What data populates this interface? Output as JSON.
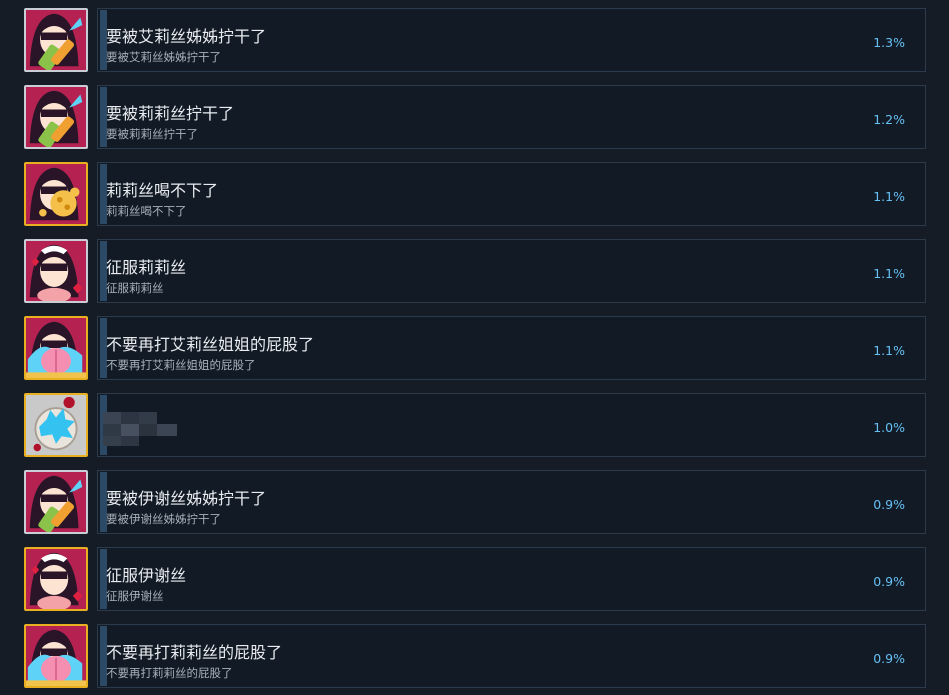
{
  "achievements": [
    {
      "title": "要被艾莉丝姊姊拧干了",
      "description": "要被艾莉丝姊姊拧干了",
      "percent": "1.3%",
      "percent_value": 1.3,
      "icon": "girl-with-lotion-icon",
      "border_color": "#c9ced6",
      "bg_color": "#b52252"
    },
    {
      "title": "要被莉莉丝拧干了",
      "description": "要被莉莉丝拧干了",
      "percent": "1.2%",
      "percent_value": 1.2,
      "icon": "girl-with-lotion-icon",
      "border_color": "#c9ced6",
      "bg_color": "#b52252"
    },
    {
      "title": "莉莉丝喝不下了",
      "description": "莉莉丝喝不下了",
      "percent": "1.1%",
      "percent_value": 1.1,
      "icon": "girl-with-splash-icon",
      "border_color": "#e8b020",
      "bg_color": "#b52252"
    },
    {
      "title": "征服莉莉丝",
      "description": "征服莉莉丝",
      "percent": "1.1%",
      "percent_value": 1.1,
      "icon": "maid-girl-hearts-icon",
      "border_color": "#c9ced6",
      "bg_color": "#b52252"
    },
    {
      "title": "不要再打艾莉丝姐姐的屁股了",
      "description": "不要再打艾莉丝姐姐的屁股了",
      "percent": "1.1%",
      "percent_value": 1.1,
      "icon": "girl-with-peach-icon",
      "border_color": "#e8b020",
      "bg_color": "#b52252"
    },
    {
      "title": "",
      "description": "",
      "percent": "1.0%",
      "percent_value": 1.0,
      "icon": "splash-plate-icon",
      "border_color": "#e8b020",
      "bg_color": "#c9c9c9",
      "hidden": true
    },
    {
      "title": "要被伊谢丝姊姊拧干了",
      "description": "要被伊谢丝姊姊拧干了",
      "percent": "0.9%",
      "percent_value": 0.9,
      "icon": "girl-with-lotion-icon",
      "border_color": "#c9ced6",
      "bg_color": "#b52252"
    },
    {
      "title": "征服伊谢丝",
      "description": "征服伊谢丝",
      "percent": "0.9%",
      "percent_value": 0.9,
      "icon": "maid-girl-hearts-icon",
      "border_color": "#e8b020",
      "bg_color": "#b52252"
    },
    {
      "title": "不要再打莉莉丝的屁股了",
      "description": "不要再打莉莉丝的屁股了",
      "percent": "0.9%",
      "percent_value": 0.9,
      "icon": "girl-with-peach-icon",
      "border_color": "#e8b020",
      "bg_color": "#b52252"
    }
  ],
  "colors": {
    "page_background": "#161c26",
    "card_border": "#2b3b4c",
    "percent_text": "#66c0f4",
    "title_text": "#e8ecf0",
    "description_text": "#a7b1bc"
  }
}
